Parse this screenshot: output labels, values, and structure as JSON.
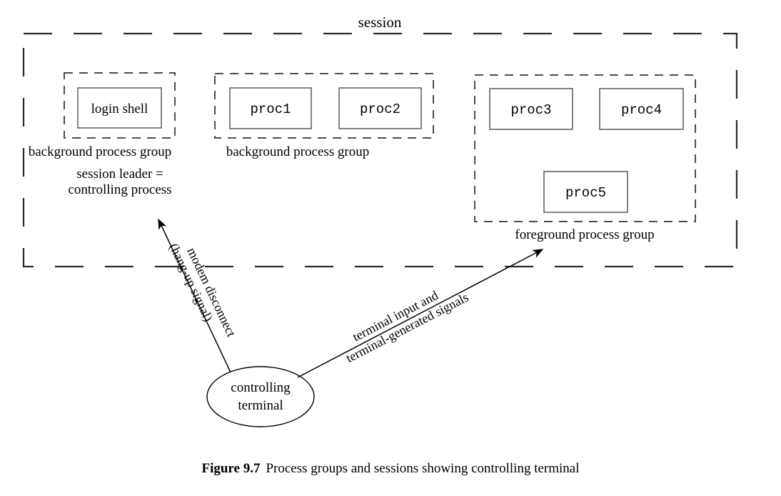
{
  "figure": {
    "session_title": "session",
    "caption_number": "Figure 9.7",
    "caption_text": "Process groups and sessions showing controlling terminal"
  },
  "colors": {
    "ink": "#000000",
    "box_stroke": "#4d4d4d",
    "session_stroke": "#2b2b2b",
    "background": "#ffffff"
  },
  "groups": [
    {
      "id": "group-login",
      "label": "background process group",
      "sublabel_line1": "session leader =",
      "sublabel_line2": "controlling process",
      "processes": [
        {
          "id": "proc-login-shell",
          "label": "login shell",
          "font": "serif"
        }
      ]
    },
    {
      "id": "group-background-2",
      "label": "background process group",
      "processes": [
        {
          "id": "proc-1",
          "label": "proc1",
          "font": "mono"
        },
        {
          "id": "proc-2",
          "label": "proc2",
          "font": "mono"
        }
      ]
    },
    {
      "id": "group-foreground",
      "label": "foreground process group",
      "processes": [
        {
          "id": "proc-3",
          "label": "proc3",
          "font": "mono"
        },
        {
          "id": "proc-4",
          "label": "proc4",
          "font": "mono"
        },
        {
          "id": "proc-5",
          "label": "proc5",
          "font": "mono"
        }
      ]
    }
  ],
  "terminal": {
    "label_line1": "controlling",
    "label_line2": "terminal"
  },
  "arrows": [
    {
      "id": "arrow-hangup",
      "label_line1": "modem disconnect",
      "label_line2": "(hang-up signal)",
      "direction": "up-left"
    },
    {
      "id": "arrow-terminal-input",
      "label_line1": "terminal input and",
      "label_line2": "terminal-generated signals",
      "direction": "up-right"
    }
  ]
}
